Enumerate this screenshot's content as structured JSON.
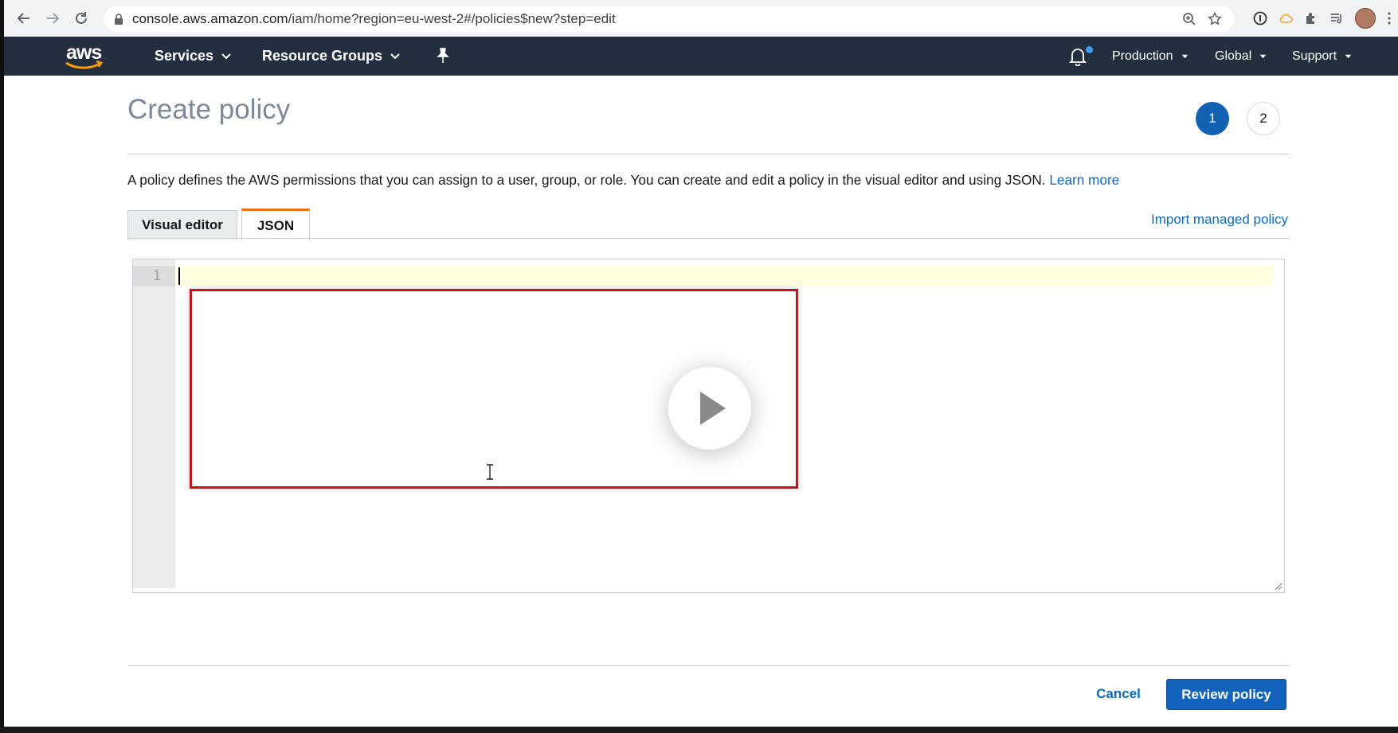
{
  "browser": {
    "url_host": "console.aws.amazon.com",
    "url_path": "/iam/home?region=eu-west-2#/policies$new?step=edit"
  },
  "header": {
    "logo_text": "aws",
    "services_label": "Services",
    "resource_groups_label": "Resource Groups",
    "account_label": "Production",
    "region_label": "Global",
    "support_label": "Support"
  },
  "page": {
    "title": "Create policy",
    "steps": [
      "1",
      "2"
    ],
    "intro_text": "A policy defines the AWS permissions that you can assign to a user, group, or role. You can create and edit a policy in the visual editor and using JSON. ",
    "learn_more": "Learn more",
    "tabs": [
      {
        "label": "Visual editor"
      },
      {
        "label": "JSON"
      }
    ],
    "import_link": "Import managed policy",
    "editor": {
      "line_numbers": [
        "1"
      ]
    }
  },
  "footer": {
    "cancel_label": "Cancel",
    "review_label": "Review policy"
  },
  "colors": {
    "aws_header": "#232f3e",
    "accent_tab": "#ec7211",
    "primary_button": "#1363bd",
    "link": "#0a6bc1",
    "video_border": "#c4141c"
  }
}
